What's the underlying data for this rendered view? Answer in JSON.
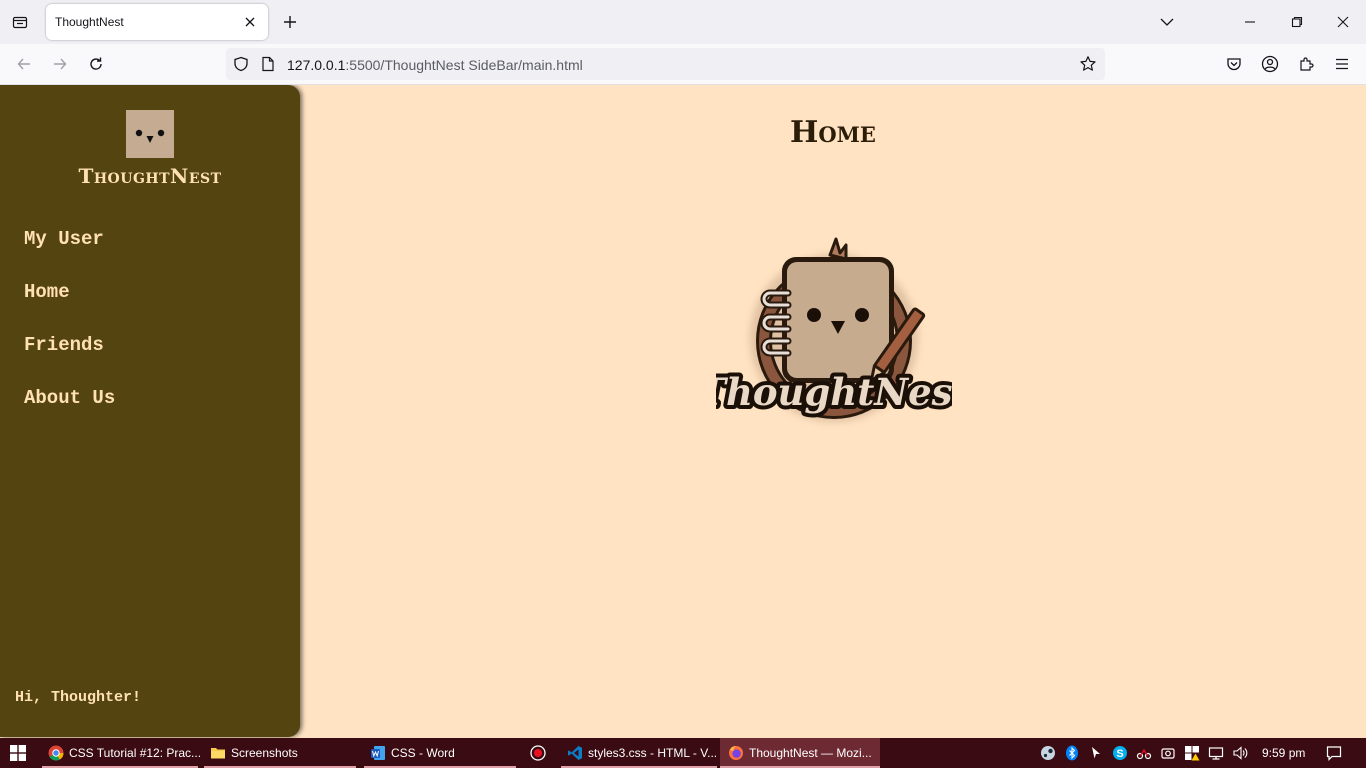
{
  "browser": {
    "tab": {
      "title": "ThoughtNest"
    },
    "url": {
      "host": "127.0.0.1",
      "rest": ":5500/ThoughtNest SideBar/main.html"
    }
  },
  "sidebar": {
    "brand": "ThoughtNest",
    "nav": [
      {
        "label": "My User"
      },
      {
        "label": "Home"
      },
      {
        "label": "Friends"
      },
      {
        "label": "About Us"
      }
    ],
    "greeting": "Hi, Thoughter!"
  },
  "main": {
    "title": "Home",
    "logo_text": "ThoughtNest"
  },
  "taskbar": {
    "items": [
      {
        "label": "CSS Tutorial #12: Prac...",
        "icon": "chrome-icon"
      },
      {
        "label": "Screenshots",
        "icon": "folder-icon"
      },
      {
        "label": "CSS - Word",
        "icon": "word-icon"
      },
      {
        "label": "styles3.css - HTML - V...",
        "icon": "vscode-icon"
      },
      {
        "label": "ThoughtNest — Mozi...",
        "icon": "firefox-icon"
      }
    ],
    "clock": "9:59 pm"
  },
  "colors": {
    "page_bg": "#ffe3c2",
    "sidebar_bg": "#54440f",
    "sidebar_text": "#ffe1b4",
    "title_text": "#2b1d08",
    "taskbar_bg": "#3a0b12"
  }
}
